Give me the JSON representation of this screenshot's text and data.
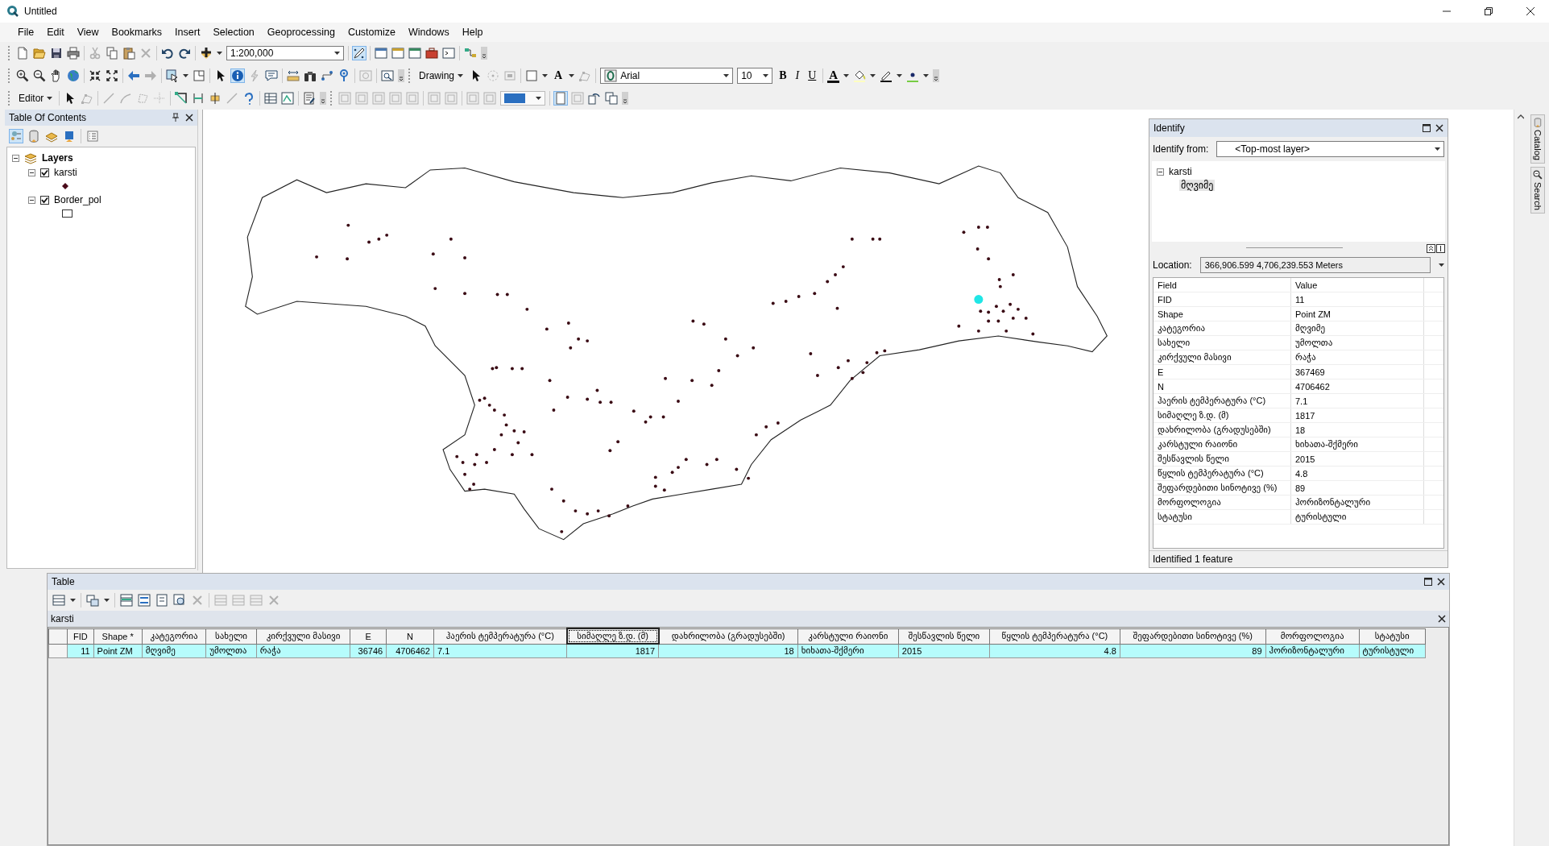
{
  "window": {
    "title": "Untitled"
  },
  "menu": [
    "File",
    "Edit",
    "View",
    "Bookmarks",
    "Insert",
    "Selection",
    "Geoprocessing",
    "Customize",
    "Windows",
    "Help"
  ],
  "standard_toolbar": {
    "scale": "1:200,000"
  },
  "draw_toolbar": {
    "label": "Drawing",
    "text_tool": "A",
    "font": "Arial",
    "font_size": "10",
    "font_color": "A",
    "styles": [
      {
        "label": "B",
        "kind": "bold"
      },
      {
        "label": "I",
        "kind": "italic"
      },
      {
        "label": "U",
        "kind": "underline"
      }
    ]
  },
  "editor_toolbar": {
    "label": "Editor"
  },
  "toc": {
    "title": "Table Of Contents",
    "root": {
      "label": "Layers",
      "expanded": true,
      "children": [
        {
          "label": "karsti",
          "checked": true,
          "expanded": true,
          "kind": "point"
        },
        {
          "label": "Border_pol",
          "checked": true,
          "expanded": true,
          "kind": "polygon"
        }
      ]
    }
  },
  "identify": {
    "title": "Identify",
    "from_label": "Identify from:",
    "from_value": "<Top-most layer>",
    "tree": {
      "label": "karsti",
      "expanded": true,
      "children": [
        {
          "label": "მღვიმე",
          "selected": true
        }
      ]
    },
    "location_label": "Location:",
    "location": "366,906.599  4,706,239.553 Meters",
    "columns": [
      "Field",
      "Value"
    ],
    "rows": [
      {
        "field": "FID",
        "value": "11"
      },
      {
        "field": "Shape",
        "value": "Point ZM"
      },
      {
        "field": "კატეგორია",
        "value": "მღვიმე"
      },
      {
        "field": "სახელი",
        "value": "უმოლთა"
      },
      {
        "field": "კირქვული მასივი",
        "value": "რაჭა"
      },
      {
        "field": "E",
        "value": "367469"
      },
      {
        "field": "N",
        "value": "4706462"
      },
      {
        "field": "ჰაერის ტემპერატურა (°C)",
        "value": "7.1"
      },
      {
        "field": "სიმაღლე ზ.დ. (მ)",
        "value": "1817"
      },
      {
        "field": "დახრილობა (გრადუსებში)",
        "value": "18"
      },
      {
        "field": "კარსტული რაიონი",
        "value": "ხიხათა-შქმერი"
      },
      {
        "field": "შესწავლის წელი",
        "value": "2015"
      },
      {
        "field": "წყლის ტემპერატურა (°C)",
        "value": "4.8"
      },
      {
        "field": "შეფარდებითი სინოტივე (%)",
        "value": "89"
      },
      {
        "field": "მორფოლოგია",
        "value": "ჰორიზონტალური"
      },
      {
        "field": "სტატუსი",
        "value": "ტურისტული"
      }
    ],
    "status": "Identified 1 feature"
  },
  "side_tabs": [
    "Catalog",
    "Search"
  ],
  "table": {
    "title": "Table",
    "layer": "karsti",
    "columns": [
      {
        "label": "FID",
        "selected": false
      },
      {
        "label": "Shape *",
        "selected": false
      },
      {
        "label": "კატეგორია",
        "selected": false
      },
      {
        "label": "სახელი",
        "selected": false
      },
      {
        "label": "კირქვული მასივი",
        "selected": false
      },
      {
        "label": "E",
        "selected": false
      },
      {
        "label": "N",
        "selected": false
      },
      {
        "label": "ჰაერის ტემპერატურა (°C)",
        "selected": false
      },
      {
        "label": "სიმაღლე ზ.დ. (მ)",
        "selected": true
      },
      {
        "label": "დახრილობა (გრადუსებში)",
        "selected": false
      },
      {
        "label": "კარსტული რაიონი",
        "selected": false
      },
      {
        "label": "შესწავლის წელი",
        "selected": false
      },
      {
        "label": "წყლის ტემპერატურა (°C)",
        "selected": false
      },
      {
        "label": "შეფარდებითი სინოტივე (%)",
        "selected": false
      },
      {
        "label": "მორფოლოგია",
        "selected": false
      },
      {
        "label": "სტატუსი",
        "selected": false
      }
    ],
    "rows": [
      {
        "selected": true,
        "cells": [
          "11",
          "Point ZM",
          "მღვიმე",
          "უმოლთა",
          "რაჭა",
          "36746",
          "4706462",
          "7.1",
          "1817",
          "18",
          "ხიხათა-შქმერი",
          "2015",
          "4.8",
          "89",
          "ჰორიზონტალური",
          "ტურისტული"
        ]
      }
    ]
  }
}
